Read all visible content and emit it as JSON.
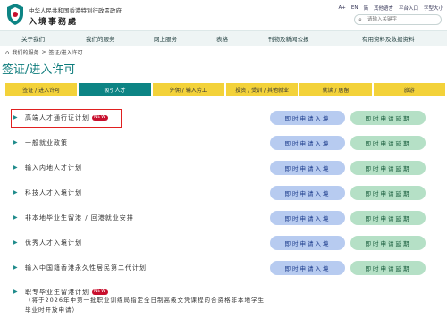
{
  "header": {
    "gov_name": "中华人民共和国香港特別行政區政府",
    "dept_name": "入境事務處",
    "tools": [
      "A+",
      "EN",
      "简",
      "其他语言",
      "平台入口",
      "字型大小"
    ],
    "search": {
      "placeholder": "请输入关键字"
    }
  },
  "nav": [
    "关于我们",
    "我们的服务",
    "网上服务",
    "表格",
    "刊物及新闻公报",
    "有用资料及数据资料"
  ],
  "breadcrumb": [
    "我们的服务",
    ">",
    "签证/进入许可"
  ],
  "page_title": "签证/进入许可",
  "tabs": [
    "签证 / 进入许可",
    "吸引人才",
    "外佣 / 输入劳工",
    "投资 / 受训 / 其他就业",
    "就读 / 居留",
    "旅游"
  ],
  "active_tab": 1,
  "schemes": [
    {
      "label": "高端人才通行证计划",
      "badge": "NEW"
    },
    {
      "label": "一般就业政策"
    },
    {
      "label": "输入内地人才计划"
    },
    {
      "label": "科技人才入境计划"
    },
    {
      "label": "非本地毕业生留港 / 回港就业安排"
    },
    {
      "label": "优秀人才入境计划"
    },
    {
      "label": "输入中国籍香港永久性居民第二代计划"
    }
  ],
  "last_scheme": {
    "label": "职专毕业生留港计划",
    "badge": "NEW",
    "note": "（将于2026年中第一批职业训练局指定全日制高级文凭课程的合资格非本地学生毕业时开放申请）"
  },
  "buttons": {
    "apply": "即时申请入境",
    "extend": "即时申请延期"
  },
  "colors": {
    "accent": "#0d8484",
    "tab": "#f3d23a",
    "apply": "#b7cbf0",
    "extend": "#b5e0c6",
    "highlight": "#e02020",
    "badge": "#c8102e"
  }
}
